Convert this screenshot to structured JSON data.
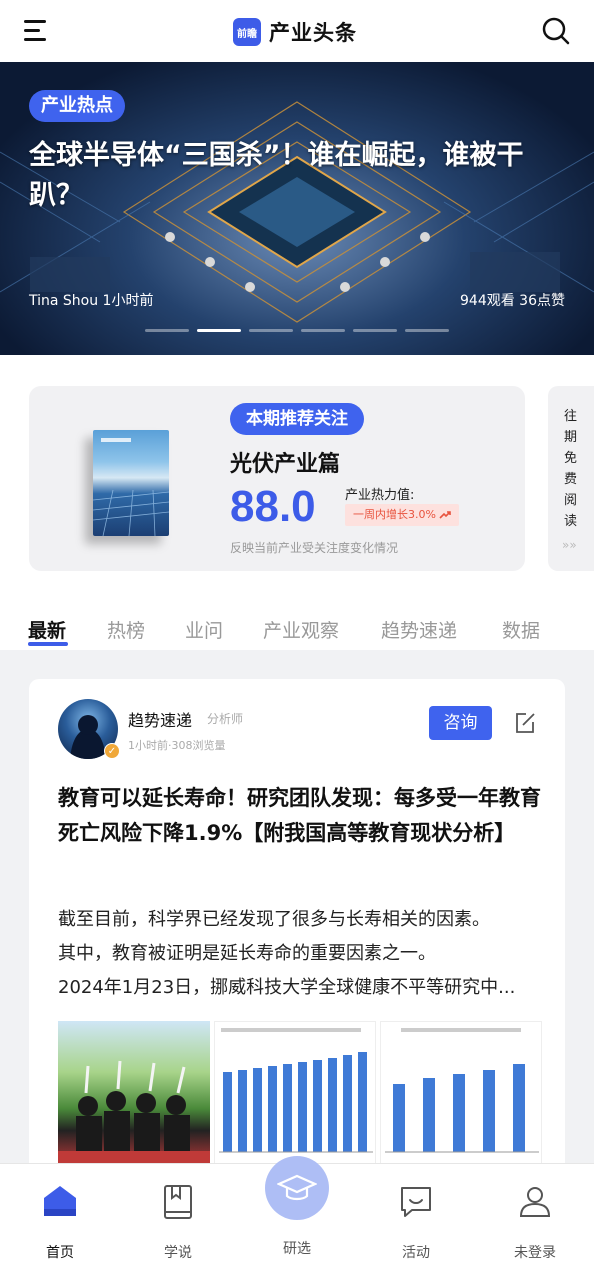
{
  "header": {
    "logo_badge": "前瞻",
    "title": "产业头条",
    "icons": [
      "menu-icon",
      "search-icon"
    ]
  },
  "banner": {
    "tag": "产业热点",
    "title": "全球半导体“三国杀”！谁在崛起，谁被干趴？",
    "author_time": "Tina Shou 1小时前",
    "stats": "944观看 36点赞",
    "slide_count": 6,
    "active_slide": 2
  },
  "recommend": {
    "badge": "本期推荐关注",
    "title": "光伏产业篇",
    "score": "88.0",
    "heat_label": "产业热力值:",
    "heat_change": "一周内增长3.0%",
    "description": "反映当前产业受关注度变化情况",
    "side_text": "往期免费阅读",
    "side_arrows": "»»"
  },
  "tabs": [
    "最新",
    "热榜",
    "业问",
    "产业观察",
    "趋势速递",
    "数据"
  ],
  "article": {
    "author": "趋势速递",
    "role": "分析师",
    "meta": "1小时前·308浏览量",
    "consult_label": "咨询",
    "title": "教育可以延长寿命！研究团队发现：每多受一年教育死亡风险下降1.9%【附我国高等教育现状分析】",
    "body_lines": [
      "截至目前，科学界已经发现了很多与长寿相关的因素。",
      "其中，教育被证明是延长寿命的重要因素之一。",
      "2024年1月23日，挪威科技大学全球健康不平等研究中..."
    ]
  },
  "bottom_nav": [
    {
      "label": "首页",
      "icon": "home-icon"
    },
    {
      "label": "学说",
      "icon": "book-icon"
    },
    {
      "label": "研选",
      "icon": "graduation-cap-icon"
    },
    {
      "label": "活动",
      "icon": "chat-icon"
    },
    {
      "label": "未登录",
      "icon": "user-icon"
    }
  ],
  "colors": {
    "accent": "#3d5ce8",
    "heat_red": "#e8533e"
  }
}
